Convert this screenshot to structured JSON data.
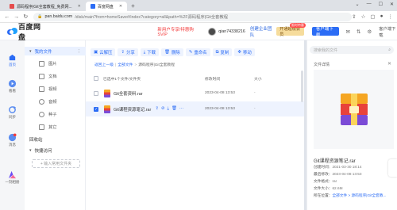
{
  "browser": {
    "tabs": [
      {
        "title": "源码程序|Git全套教程_免费网...",
        "active": false
      },
      {
        "title": "百度网盘",
        "active": true
      }
    ],
    "url_host": "pan.baidu.com",
    "url_path": "/disk/main?from=homeSave#/index?category=all&path=%2F源码程序|Git全套教程"
  },
  "header": {
    "logo_text": "百度网盘",
    "promo": "新用户专享!特惠购SVIP",
    "username": "qian74338216",
    "svip_link": "创建企业团队",
    "svip_badge": "开通超级会员",
    "svip_hot": "限时特惠",
    "client_button": "客户端下载",
    "client_label": "客户端下载"
  },
  "rail": [
    {
      "label": "首页",
      "icon": "home-icon",
      "active": true
    },
    {
      "label": "看看",
      "icon": "play-icon",
      "active": false
    },
    {
      "label": "同步",
      "icon": "sync-icon",
      "active": false
    },
    {
      "label": "消息",
      "icon": "message-icon",
      "active": false
    },
    {
      "label": "一刻相册",
      "icon": "album-icon",
      "active": false
    }
  ],
  "leftnav": {
    "my_files": "我的文件",
    "items": [
      {
        "label": "图片",
        "icon": "image-icon"
      },
      {
        "label": "文档",
        "icon": "doc-icon"
      },
      {
        "label": "视频",
        "icon": "video-icon"
      },
      {
        "label": "音频",
        "icon": "audio-icon"
      },
      {
        "label": "种子",
        "icon": "seed-icon"
      },
      {
        "label": "其它",
        "icon": "other-icon"
      }
    ],
    "recycle": "回收站",
    "quick_access": "快捷访问",
    "add_quick": "+ 输入常用文件夹"
  },
  "toolbar": [
    {
      "label": "云解压",
      "icon": "unzip-icon"
    },
    {
      "label": "分享",
      "icon": "share-icon"
    },
    {
      "label": "下载",
      "icon": "download-icon"
    },
    {
      "label": "删除",
      "icon": "delete-icon"
    },
    {
      "label": "重命名",
      "icon": "rename-icon"
    },
    {
      "label": "复制",
      "icon": "copy-icon"
    },
    {
      "label": "移动",
      "icon": "move-icon"
    }
  ],
  "breadcrumb": {
    "back": "返回上一级",
    "all": "全部文件",
    "current": "源码程序|Git全套教程"
  },
  "table": {
    "selected_info": "已选中1个文件/文件夹",
    "col_date": "修改时间",
    "col_size": "大小",
    "rows": [
      {
        "name": "Git全套资料.rar",
        "date": "2023-04-08 13:53",
        "size": "-",
        "selected": false
      },
      {
        "name": "Git课程资源笔记.rar",
        "date": "2023-04-08 13:53",
        "size": "-",
        "selected": true
      }
    ]
  },
  "detail": {
    "search_placeholder": "搜索我的文件",
    "title": "文件详情",
    "filename": "Git课程资源笔记.rar",
    "meta": [
      {
        "k": "创建时间：",
        "v": "2021-03-30 18:14"
      },
      {
        "k": "最后修改：",
        "v": "2023-04-08 13:53"
      },
      {
        "k": "文件格式：",
        "v": "rar"
      },
      {
        "k": "文件大小：",
        "v": "62.6M"
      },
      {
        "k": "所在位置：",
        "v": "全部文件 > 源码程序|Git全套教..."
      }
    ]
  },
  "colors": {
    "accent": "#2b6cf5",
    "selected_row": "#eef3fe",
    "promo": "#f33a3a"
  }
}
